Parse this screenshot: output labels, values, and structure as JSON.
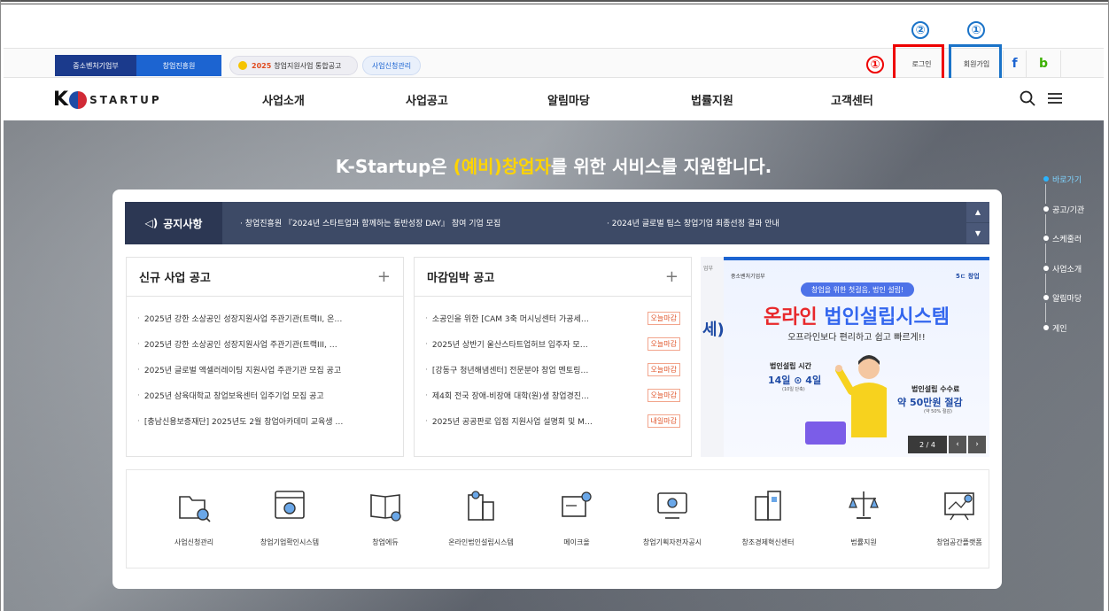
{
  "util": {
    "smes_label": "중소벤처기업부",
    "kised_label": "창업진흥원",
    "notice_year": "2025",
    "notice_label": "창업지원사업 통합공고",
    "app_mgmt_label": "사업신청관리",
    "login_label": "로그인",
    "join_label": "회원가입",
    "facebook_label": "f",
    "blog_label": "b"
  },
  "annotations": {
    "red_num": "①",
    "login_num": "②",
    "join_num": "①"
  },
  "gnb": {
    "logo_k": "K",
    "logo_text": "STARTUP",
    "menu": [
      "사업소개",
      "사업공고",
      "알림마당",
      "법률지원",
      "고객센터"
    ]
  },
  "hero": {
    "title_prefix": "K-Startup은 ",
    "title_highlight": "(예비)창업자",
    "title_suffix": "를 위한 서비스를 지원합니다."
  },
  "quick_nav": [
    "바로가기",
    "공고/기관",
    "스케줄러",
    "사업소개",
    "알림마당",
    "게인"
  ],
  "notice": {
    "label": "공지사항",
    "items": [
      "· 창업진흥원 『2024년 스타트업과 함께하는 동반성장 DAY』 참여 기업 모집",
      "· 2024년 글로벌 팁스 창업기업 최종선정 결과 안내"
    ],
    "up": "▲",
    "down": "▼"
  },
  "panels": {
    "new": {
      "title": "신규 사업 공고",
      "plus": "+",
      "items": [
        "2025년 강한 소상공인 성장지원사업 주관기관(트랙II, 온…",
        "2025년 강한 소상공인 성장지원사업 주관기관(트랙III, …",
        "2025년 글로벌 액셀러레이팅 지원사업 주관기관 모집 공고",
        "2025년 삼육대학교 창업보육센터 입주기업 모집 공고",
        "[충남신용보증재단] 2025년도 2월 창업아카데미 교육생 …"
      ]
    },
    "deadline": {
      "title": "마감임박 공고",
      "plus": "+",
      "items": [
        {
          "text": "소공인을 위한 [CAM 3축 머시닝센터 가공세…",
          "tag": "오늘마감"
        },
        {
          "text": "2025년 상반기 울산스타트업허브 입주자 모…",
          "tag": "오늘마감"
        },
        {
          "text": "[강동구 청년해냄센터] 전문분야 창업 멘토링…",
          "tag": "오늘마감"
        },
        {
          "text": "제4회 전국 장애-비장애 대학(원)생 창업경진…",
          "tag": "오늘마감"
        },
        {
          "text": "2025년 공공판로 입점 지원사업 설명회 및 M…",
          "tag": "내일마감"
        }
      ]
    }
  },
  "banner": {
    "left_mini": "업부",
    "left_text": "세)",
    "org": "중소벤처기업부",
    "logo_r": "5ㄷ 창업",
    "pill": "창업을 위한 첫걸음, 법인 설립!",
    "head_red": "온라인",
    "head_blue": " 법인설립시스템",
    "sub": "오프라인보다 편리하고 쉽고 빠르게!!",
    "time_label": "법인설립 시간",
    "time_val": "14일 ⊙ 4일",
    "time_note": "(10일 단축)",
    "fee_label": "법인설립 수수료",
    "fee_val": "약 50만원 절감",
    "fee_note": "(약 50% 절감)",
    "count": "2 / 4",
    "prev": "‹",
    "next": "›"
  },
  "services": [
    {
      "label": "사업신청관리",
      "icon": "folder-search-icon"
    },
    {
      "label": "창업기업확인시스템",
      "icon": "window-check-icon"
    },
    {
      "label": "창업에듀",
      "icon": "book-icon"
    },
    {
      "label": "온라인법인설립시스템",
      "icon": "building-doc-icon"
    },
    {
      "label": "메이크올",
      "icon": "gear-screen-icon"
    },
    {
      "label": "창업기획자전자공시",
      "icon": "monitor-icon"
    },
    {
      "label": "창조경제혁신센터",
      "icon": "office-building-icon"
    },
    {
      "label": "법률지원",
      "icon": "scale-icon"
    },
    {
      "label": "창업공간플랫폼",
      "icon": "map-board-icon"
    }
  ],
  "colors": {
    "brand_dark": "#1b3a8c",
    "brand_blue": "#1c64d1",
    "annotation_red": "#e00000",
    "annotation_blue": "#1a73c8",
    "highlight": "#ffd400"
  }
}
